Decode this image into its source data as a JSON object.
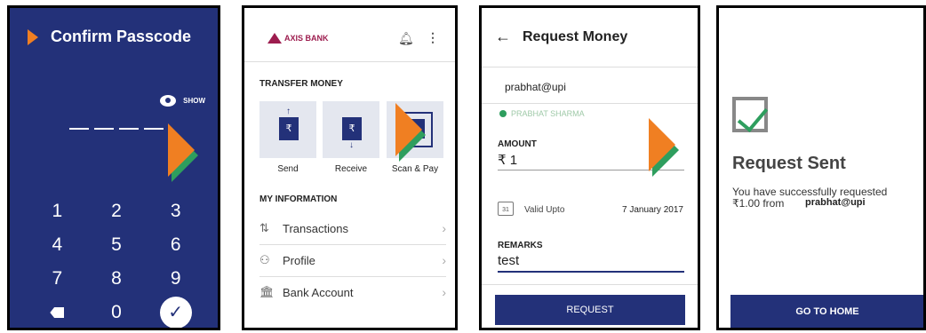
{
  "screen1": {
    "title": "Confirm Passcode",
    "show_label": "SHOW",
    "keys": [
      "1",
      "2",
      "3",
      "4",
      "5",
      "6",
      "7",
      "8",
      "9"
    ],
    "zero": "0",
    "done_symbol": "✓"
  },
  "screen2": {
    "bank_name": "AXIS BANK",
    "transfer_heading": "TRANSFER MONEY",
    "send": "Send",
    "receive": "Receive",
    "scan_pay": "Scan & Pay",
    "rupee": "₹",
    "plus": "+",
    "info_heading": "MY INFORMATION",
    "transactions": "Transactions",
    "profile": "Profile",
    "bank_account": "Bank Account"
  },
  "screen3": {
    "back_symbol": "←",
    "title": "Request Money",
    "vpa": "prabhat@upi",
    "payee_name": "PRABHAT SHARMA",
    "amount_label": "AMOUNT",
    "amount_value": "₹ 1",
    "calendar_day": "31",
    "valid_label": "Valid Upto",
    "valid_date": "7 January 2017",
    "remarks_label": "REMARKS",
    "remarks_value": "test",
    "request_button": "REQUEST"
  },
  "screen4": {
    "title": "Request Sent",
    "message_line1": "You have successfully requested",
    "message_line2": "₹1.00 from",
    "vpa": "prabhat@upi",
    "home_button": "GO TO HOME"
  },
  "colors": {
    "brand_blue": "#233179",
    "bhim_orange": "#f07f22",
    "bhim_green": "#2e9e5e",
    "axis_maroon": "#9d1d4f"
  }
}
